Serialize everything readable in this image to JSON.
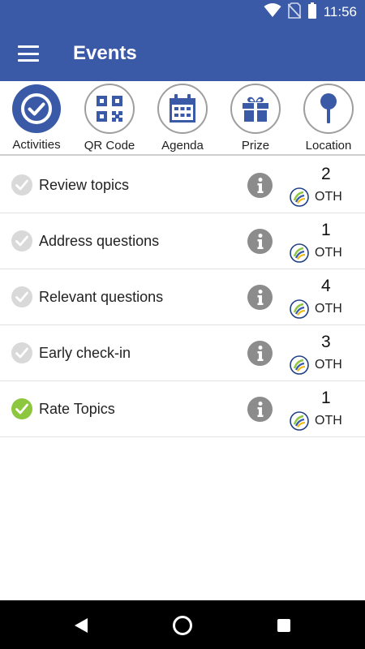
{
  "status_bar": {
    "time": "11:56",
    "icons": [
      "wifi-icon",
      "no-sim-icon",
      "battery-icon"
    ]
  },
  "app_bar": {
    "title": "Events",
    "menu_icon": "hamburger-menu-icon"
  },
  "tabs": [
    {
      "label": "Activities",
      "icon": "check-circle-icon",
      "active": true
    },
    {
      "label": "QR Code",
      "icon": "qr-code-icon",
      "active": false
    },
    {
      "label": "Agenda",
      "icon": "calendar-icon",
      "active": false
    },
    {
      "label": "Prize",
      "icon": "gift-icon",
      "active": false
    },
    {
      "label": "Location",
      "icon": "map-pin-icon",
      "active": false
    }
  ],
  "activities": [
    {
      "label": "Review topics",
      "points": "2",
      "currency": "OTH",
      "completed": false
    },
    {
      "label": "Address questions",
      "points": "1",
      "currency": "OTH",
      "completed": false
    },
    {
      "label": "Relevant questions",
      "points": "4",
      "currency": "OTH",
      "completed": false
    },
    {
      "label": "Early check-in",
      "points": "3",
      "currency": "OTH",
      "completed": false
    },
    {
      "label": "Rate Topics",
      "points": "1",
      "currency": "OTH",
      "completed": true
    }
  ],
  "nav_bar": {
    "icons": [
      "back-icon",
      "home-icon",
      "recents-icon"
    ]
  },
  "colors": {
    "primary": "#3a5aa8",
    "completed": "#8dc63f",
    "pending": "#d9d9d9",
    "info": "#8c8c8c"
  }
}
